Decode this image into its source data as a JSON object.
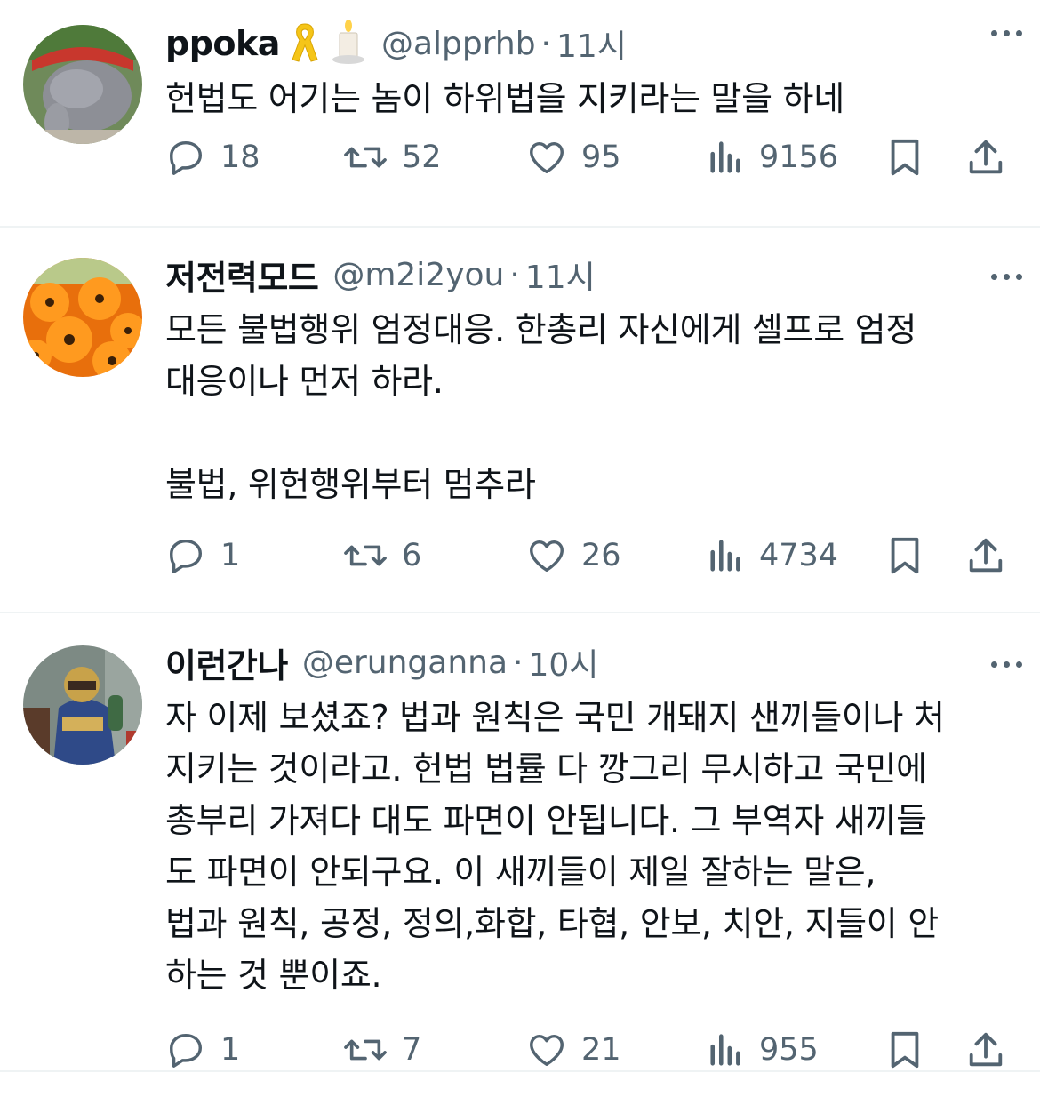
{
  "posts": [
    {
      "name": "ppoka",
      "handle": "@alpprhb",
      "sep": "·",
      "time": "11시",
      "text": "헌법도 어기는 놈이 하위법을 지키라는 말을 하네",
      "stats": {
        "replies": "18",
        "reposts": "52",
        "likes": "95",
        "views": "9156"
      },
      "avatar_icon": "gray-cat-avatar",
      "name_emojis": [
        "yellow-ribbon-icon",
        "candle-icon"
      ]
    },
    {
      "name": "저전력모드",
      "handle": "@m2i2you",
      "sep": "·",
      "time": "11시",
      "text": "모든 불법행위 엄정대응.  한총리 자신에게 셀프로 엄정\n대응이나 먼저 하라.\n\n불법, 위헌행위부터 멈추라",
      "stats": {
        "replies": "1",
        "reposts": "6",
        "likes": "26",
        "views": "4734"
      },
      "avatar_icon": "orange-flowers-avatar"
    },
    {
      "name": "이런간나",
      "handle": "@erunganna",
      "sep": "·",
      "time": "10시",
      "text": "자 이제 보셨죠? 법과 원칙은 국민 개돼지 샌끼들이나 처\n지키는 것이라고. 헌법 법률 다 깡그리 무시하고 국민에\n총부리 가져다 대도 파면이 안됩니다. 그 부역자 새끼들\n도 파면이 안되구요. 이 새끼들이 제일 잘하는 말은,\n법과 원칙, 공정, 정의,화합, 타협, 안보, 치안, 지들이 안\n하는 것 뿐이죠.",
      "stats": {
        "replies": "1",
        "reposts": "7",
        "likes": "21",
        "views": "955"
      },
      "avatar_icon": "armored-figure-avatar"
    }
  ],
  "colors": {
    "text": "#0f1419",
    "secondary": "#536471",
    "divider": "#eff3f4",
    "ribbon": "#f5c518"
  }
}
